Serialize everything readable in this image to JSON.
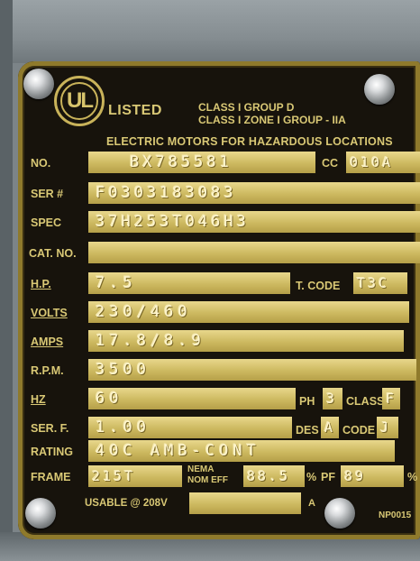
{
  "plate": {
    "listed": "LISTED",
    "ul_mark": "UL",
    "class_line1": "CLASS I  GROUP D",
    "class_line2": "CLASS I ZONE I GROUP - IIA",
    "hazard_line": "ELECTRIC MOTORS FOR HAZARDOUS LOCATIONS"
  },
  "labels": {
    "no": "NO.",
    "cc": "CC",
    "ser": "SER #",
    "spec": "SPEC",
    "cat_no": "CAT. NO.",
    "hp": "H.P.",
    "t_code": "T. CODE",
    "volts": "VOLTS",
    "amps": "AMPS",
    "rpm": "R.P.M.",
    "hz": "HZ",
    "ph": "PH",
    "class": "CLASS",
    "ser_f": "SER. F.",
    "des": "DES",
    "code": "CODE",
    "rating": "RATING",
    "frame": "FRAME",
    "nema": "NEMA",
    "nom_eff": "NOM EFF",
    "pct": "%",
    "pf": "PF",
    "pct2": "%",
    "usable": "USABLE @ 208V",
    "a": "A",
    "part_no": "NP0015"
  },
  "values": {
    "no": "BX785581",
    "cc": "010A",
    "ser": "F0303183083",
    "spec": "37H253T046H3",
    "cat_no": "",
    "hp": "7.5",
    "t_code": "T3C",
    "volts": "230/460",
    "amps": "17.8/8.9",
    "rpm": "3500",
    "hz": "60",
    "ph": "3",
    "class": "F",
    "ser_f": "1.00",
    "des": "A",
    "code": "J",
    "rating": "40C AMB-CONT",
    "frame": "215T",
    "nom_eff": "88.5",
    "pf": "89",
    "usable": "",
    "a": ""
  }
}
